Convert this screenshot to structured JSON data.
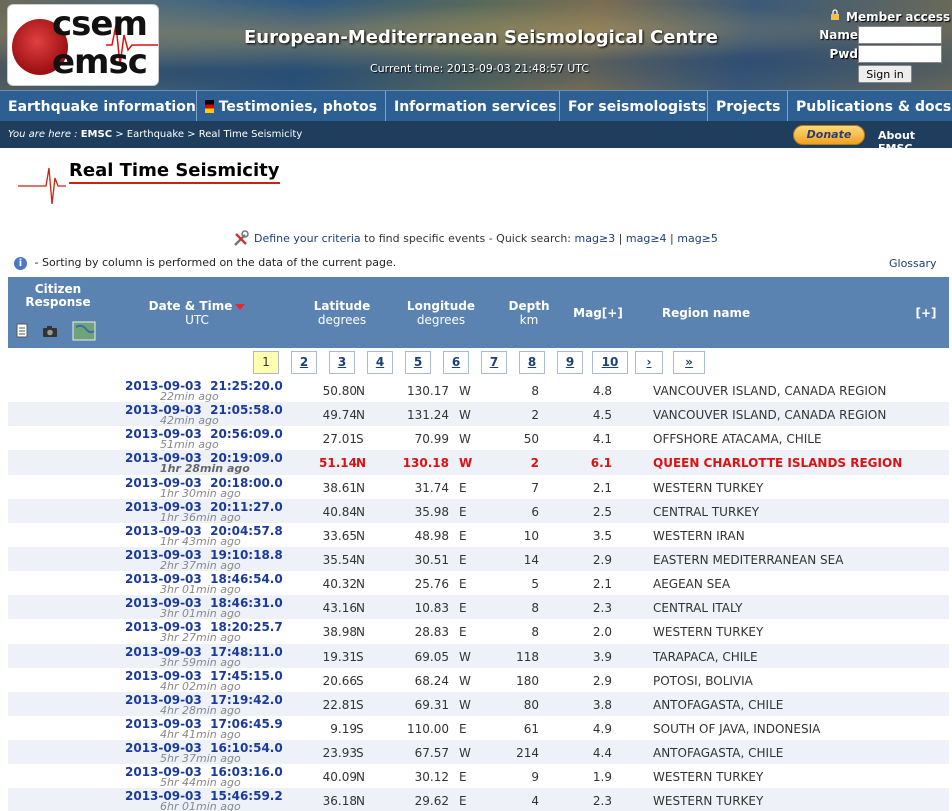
{
  "header": {
    "logo_line1": "csem",
    "logo_line2": "emsc",
    "title": "European-Mediterranean Seismological Centre",
    "current_time": "Current time: 2013-09-03 21:48:57 UTC",
    "login": {
      "member_access": "Member access",
      "name_label": "Name",
      "pwd_label": "Pwd",
      "sign_in": "Sign in"
    }
  },
  "nav": [
    "Earthquake information",
    "Testimonies, photos",
    "Information services",
    "For seismologists",
    "Projects",
    "Publications & docs"
  ],
  "breadcrumb": {
    "prefix": "You are here : ",
    "home": "EMSC",
    "rest": " > Earthquake > Real Time Seismicity"
  },
  "donate": "Donate",
  "about": "About EMSC",
  "page_title": "Real Time Seismicity",
  "criteria": {
    "link": "Define your criteria",
    "text": " to find specific events - Quick search: ",
    "q1": "mag≥3",
    "q2": "mag≥4",
    "q3": "mag≥5",
    "sep": " | "
  },
  "sort_note": " - Sorting by column is performed on the data of the current page.",
  "glossary": "Glossary",
  "table_head": {
    "citizen": "Citizen Response",
    "datetime": "Date & Time",
    "datetime_sub": "UTC",
    "lat": "Latitude",
    "lat_sub": "degrees",
    "lon": "Longitude",
    "lon_sub": "degrees",
    "depth": "Depth",
    "depth_sub": "km",
    "mag": "Mag[+]",
    "region": "Region name",
    "plus": "[+]"
  },
  "pages": [
    "1",
    "2",
    "3",
    "4",
    "5",
    "6",
    "7",
    "8",
    "9",
    "10",
    "›",
    "»"
  ],
  "rows": [
    {
      "dt": "2013-09-03  21:25:20.0",
      "ago": "22min ago",
      "lat": "50.80",
      "ns": "N",
      "lon": "130.17",
      "ew": "W",
      "depth": "8",
      "mag": "4.8",
      "region": "VANCOUVER ISLAND, CANADA REGION"
    },
    {
      "dt": "2013-09-03  21:05:58.0",
      "ago": "42min ago",
      "lat": "49.74",
      "ns": "N",
      "lon": "131.24",
      "ew": "W",
      "depth": "2",
      "mag": "4.5",
      "region": "VANCOUVER ISLAND, CANADA REGION"
    },
    {
      "dt": "2013-09-03  20:56:09.0",
      "ago": "51min ago",
      "lat": "27.01",
      "ns": "S",
      "lon": "70.99",
      "ew": "W",
      "depth": "50",
      "mag": "4.1",
      "region": "OFFSHORE ATACAMA, CHILE"
    },
    {
      "dt": "2013-09-03  20:19:09.0",
      "ago": "1hr 28min ago",
      "lat": "51.14",
      "ns": "N",
      "lon": "130.18",
      "ew": "W",
      "depth": "2",
      "mag": "6.1",
      "region": "QUEEN CHARLOTTE ISLANDS REGION"
    },
    {
      "dt": "2013-09-03  20:18:00.0",
      "ago": "1hr 30min ago",
      "lat": "38.61",
      "ns": "N",
      "lon": "31.74",
      "ew": "E",
      "depth": "7",
      "mag": "2.1",
      "region": "WESTERN TURKEY"
    },
    {
      "dt": "2013-09-03  20:11:27.0",
      "ago": "1hr 36min ago",
      "lat": "40.84",
      "ns": "N",
      "lon": "35.98",
      "ew": "E",
      "depth": "6",
      "mag": "2.5",
      "region": "CENTRAL TURKEY"
    },
    {
      "dt": "2013-09-03  20:04:57.8",
      "ago": "1hr 43min ago",
      "lat": "33.65",
      "ns": "N",
      "lon": "48.98",
      "ew": "E",
      "depth": "10",
      "mag": "3.5",
      "region": "WESTERN IRAN"
    },
    {
      "dt": "2013-09-03  19:10:18.8",
      "ago": "2hr 37min ago",
      "lat": "35.54",
      "ns": "N",
      "lon": "30.51",
      "ew": "E",
      "depth": "14",
      "mag": "2.9",
      "region": "EASTERN MEDITERRANEAN SEA"
    },
    {
      "dt": "2013-09-03  18:46:54.0",
      "ago": "3hr 01min ago",
      "lat": "40.32",
      "ns": "N",
      "lon": "25.76",
      "ew": "E",
      "depth": "5",
      "mag": "2.1",
      "region": "AEGEAN SEA"
    },
    {
      "dt": "2013-09-03  18:46:31.0",
      "ago": "3hr 01min ago",
      "lat": "43.16",
      "ns": "N",
      "lon": "10.83",
      "ew": "E",
      "depth": "8",
      "mag": "2.3",
      "region": "CENTRAL ITALY"
    },
    {
      "dt": "2013-09-03  18:20:25.7",
      "ago": "3hr 27min ago",
      "lat": "38.98",
      "ns": "N",
      "lon": "28.83",
      "ew": "E",
      "depth": "8",
      "mag": "2.0",
      "region": "WESTERN TURKEY"
    },
    {
      "dt": "2013-09-03  17:48:11.0",
      "ago": "3hr 59min ago",
      "lat": "19.31",
      "ns": "S",
      "lon": "69.05",
      "ew": "W",
      "depth": "118",
      "mag": "3.9",
      "region": "TARAPACA, CHILE"
    },
    {
      "dt": "2013-09-03  17:45:15.0",
      "ago": "4hr 02min ago",
      "lat": "20.66",
      "ns": "S",
      "lon": "68.24",
      "ew": "W",
      "depth": "180",
      "mag": "2.9",
      "region": "POTOSI, BOLIVIA"
    },
    {
      "dt": "2013-09-03  17:19:42.0",
      "ago": "4hr 28min ago",
      "lat": "22.81",
      "ns": "S",
      "lon": "69.31",
      "ew": "W",
      "depth": "80",
      "mag": "3.8",
      "region": "ANTOFAGASTA, CHILE"
    },
    {
      "dt": "2013-09-03  17:06:45.9",
      "ago": "4hr 41min ago",
      "lat": "9.19",
      "ns": "S",
      "lon": "110.00",
      "ew": "E",
      "depth": "61",
      "mag": "4.9",
      "region": "SOUTH OF JAVA, INDONESIA"
    },
    {
      "dt": "2013-09-03  16:10:54.0",
      "ago": "5hr 37min ago",
      "lat": "23.93",
      "ns": "S",
      "lon": "67.57",
      "ew": "W",
      "depth": "214",
      "mag": "4.4",
      "region": "ANTOFAGASTA, CHILE"
    },
    {
      "dt": "2013-09-03  16:03:16.0",
      "ago": "5hr 44min ago",
      "lat": "40.09",
      "ns": "N",
      "lon": "30.12",
      "ew": "E",
      "depth": "9",
      "mag": "1.9",
      "region": "WESTERN TURKEY"
    },
    {
      "dt": "2013-09-03  15:46:59.2",
      "ago": "6hr 01min ago",
      "lat": "36.18",
      "ns": "N",
      "lon": "29.62",
      "ew": "E",
      "depth": "4",
      "mag": "2.3",
      "region": "WESTERN TURKEY"
    }
  ],
  "highlight_row": 3,
  "colors": {
    "nav_bg": "#2d5f93",
    "header_row_bg": "#5b83b1",
    "highlight": "#dd1111",
    "link": "#1a3a9c"
  }
}
